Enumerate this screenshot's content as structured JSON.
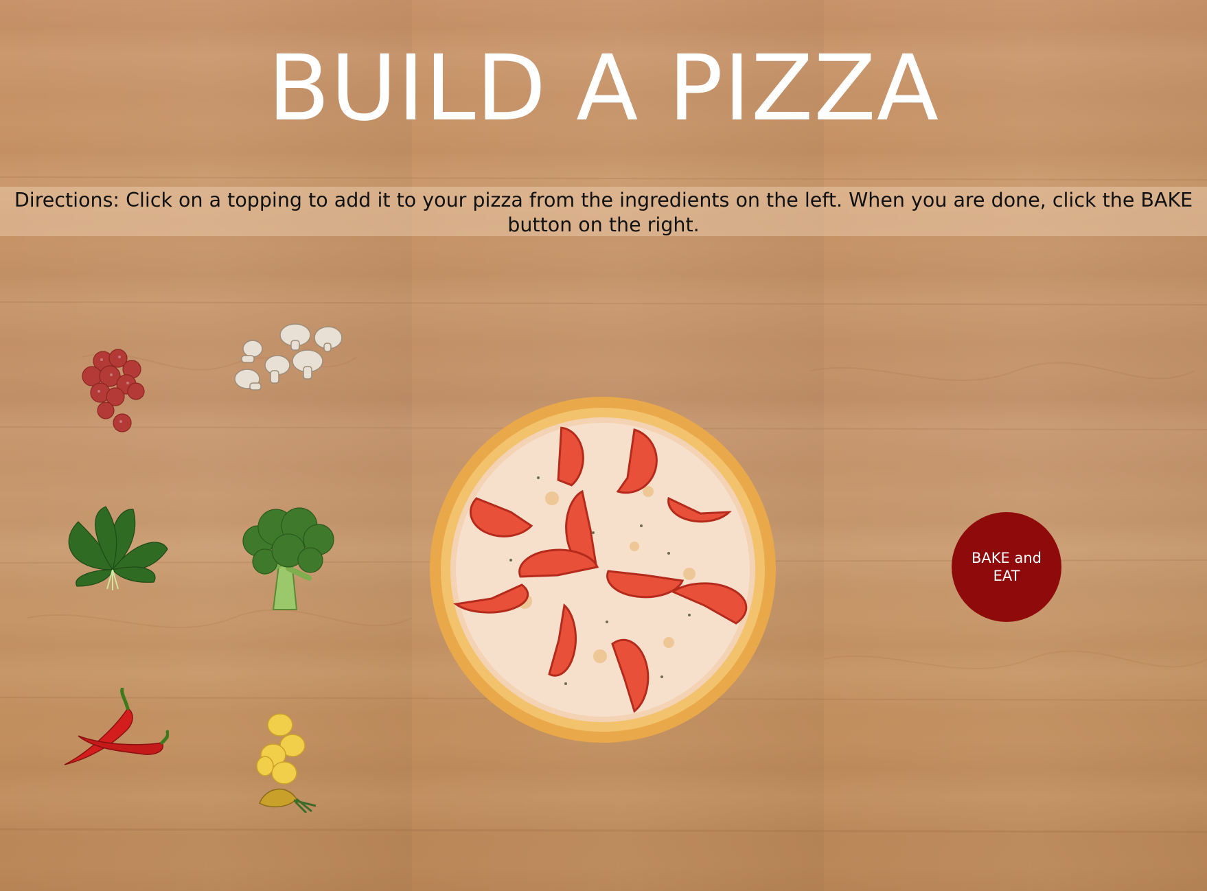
{
  "page": {
    "title": "BUILD A PIZZA",
    "directions": "Directions: Click on a topping to add it to your pizza from the ingredients on the left. When you are done, click the BAKE button on the right."
  },
  "toppings": [
    {
      "name": "pepperoni",
      "icon": "pepperoni-icon"
    },
    {
      "name": "mushrooms",
      "icon": "mushroom-icon"
    },
    {
      "name": "spinach",
      "icon": "spinach-icon"
    },
    {
      "name": "broccoli",
      "icon": "broccoli-icon"
    },
    {
      "name": "chili peppers",
      "icon": "chili-pepper-icon"
    },
    {
      "name": "pineapple",
      "icon": "pineapple-icon"
    }
  ],
  "pizza": {
    "icon": "pizza-icon",
    "topping_shown": "tomato"
  },
  "bake_button": {
    "label": "BAKE and EAT",
    "color": "#8f0a0a"
  },
  "colors": {
    "title": "#ffffff",
    "wood": "#c8936a"
  }
}
